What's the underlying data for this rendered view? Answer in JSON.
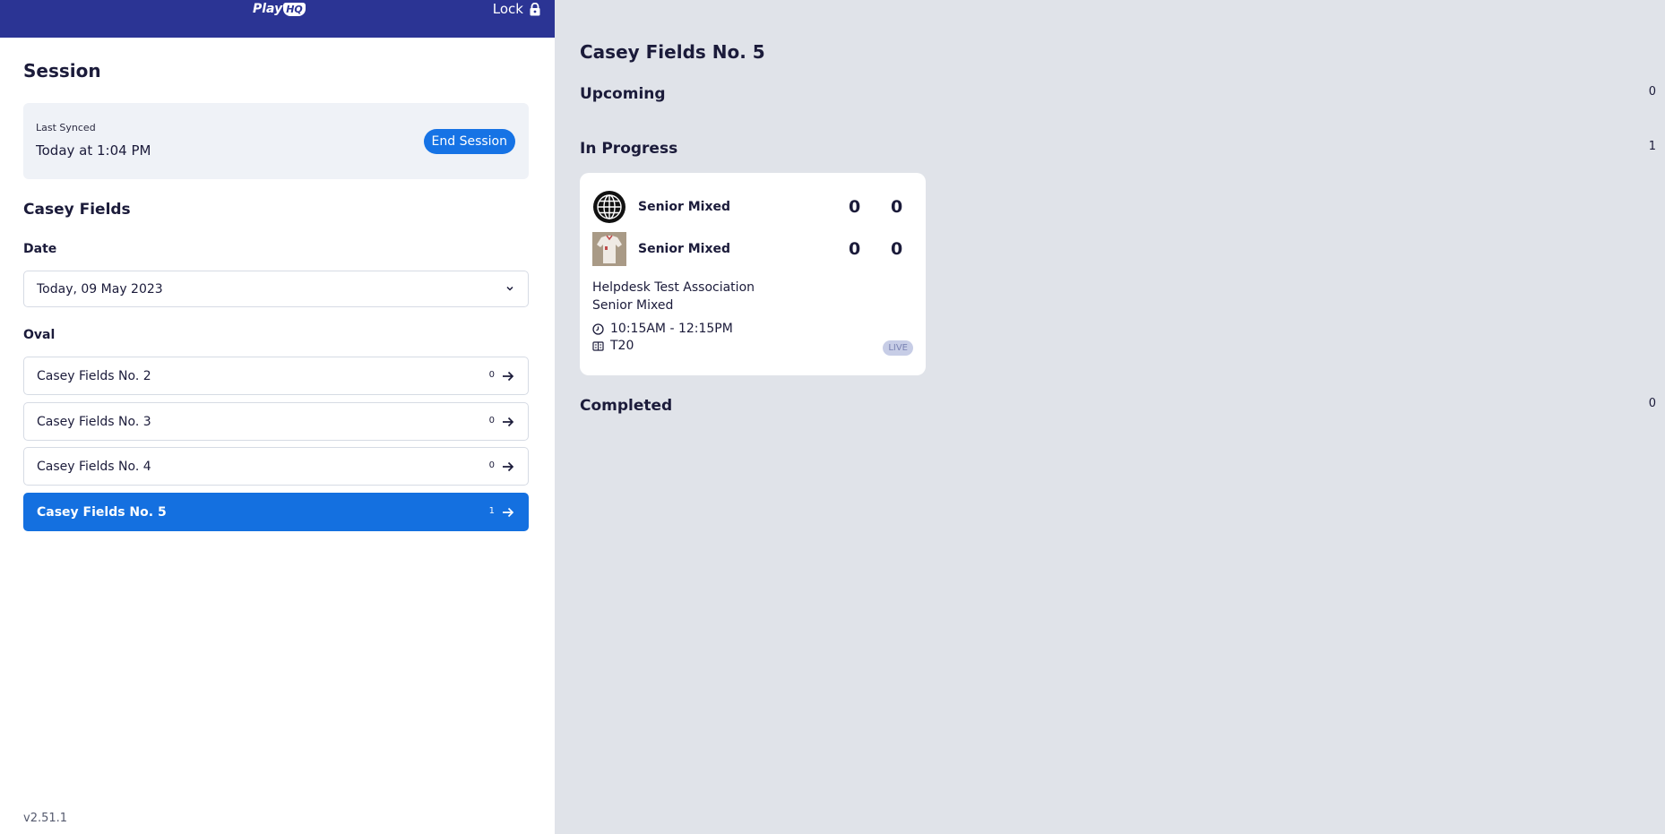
{
  "header": {
    "logo_text": "Play",
    "logo_badge": "HQ",
    "lock_label": "Lock"
  },
  "session": {
    "title": "Session",
    "last_synced_label": "Last Synced",
    "last_synced_value": "Today at 1:04 PM",
    "end_session_label": "End Session"
  },
  "venue": {
    "name": "Casey Fields",
    "date_label": "Date",
    "date_value": "Today, 09 May 2023",
    "oval_label": "Oval",
    "ovals": [
      {
        "name": "Casey Fields No. 2",
        "count": "0"
      },
      {
        "name": "Casey Fields No. 3",
        "count": "0"
      },
      {
        "name": "Casey Fields No. 4",
        "count": "0"
      },
      {
        "name": "Casey Fields No. 5",
        "count": "1"
      }
    ]
  },
  "version": "v2.51.1",
  "main": {
    "title": "Casey Fields No. 5",
    "upcoming": {
      "label": "Upcoming",
      "count": "0"
    },
    "in_progress": {
      "label": "In Progress",
      "count": "1"
    },
    "completed": {
      "label": "Completed",
      "count": "0"
    },
    "match": {
      "team1": {
        "name": "Senior Mixed",
        "score1": "0",
        "score2": "0"
      },
      "team2": {
        "name": "Senior Mixed",
        "score1": "0",
        "score2": "0"
      },
      "competition": "Helpdesk Test Association",
      "grade": "Senior Mixed",
      "time": "10:15AM - 12:15PM",
      "format": "T20",
      "status": "LIVE"
    }
  },
  "colors": {
    "header_bg": "#2b3494",
    "accent": "#1470e0",
    "right_bg": "#e0e3e9"
  },
  "icons": [
    "lock-icon",
    "chevron-down-icon",
    "arrow-right-icon",
    "globe-icon",
    "clock-icon",
    "scoreboard-icon"
  ]
}
